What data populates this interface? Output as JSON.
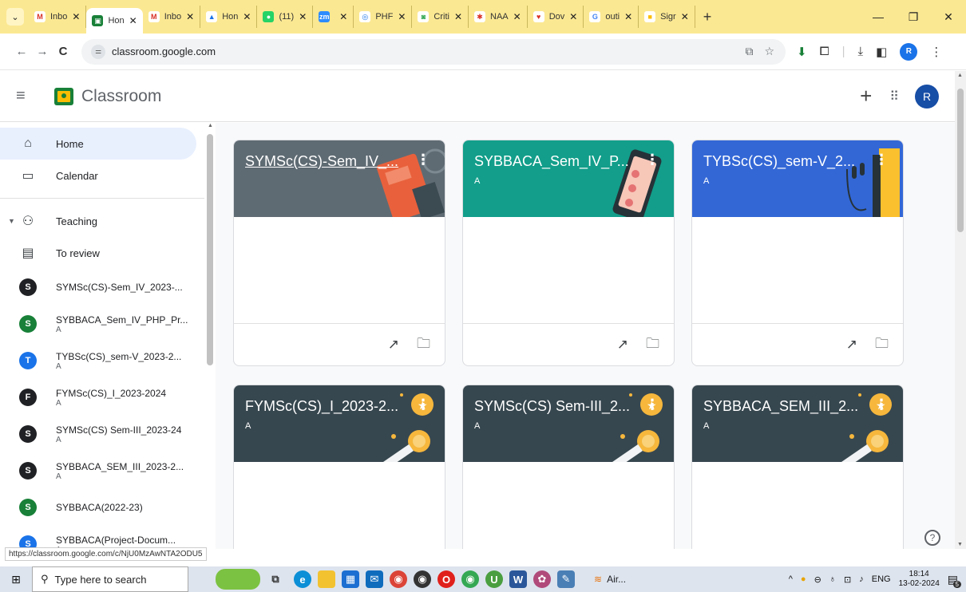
{
  "browser": {
    "tabs": [
      {
        "label": "Inbo",
        "fav": "M",
        "color": "#ffffff",
        "fg": "#d93025",
        "active": false
      },
      {
        "label": "Hon",
        "fav": "▣",
        "color": "#188038",
        "fg": "#ffffff",
        "active": true
      },
      {
        "label": "Inbo",
        "fav": "M",
        "color": "#ffffff",
        "fg": "#d93025",
        "active": false
      },
      {
        "label": "Hon",
        "fav": "▲",
        "color": "#ffffff",
        "fg": "#1a73e8",
        "active": false
      },
      {
        "label": "(11)",
        "fav": "●",
        "color": "#25d366",
        "fg": "#ffffff",
        "active": false
      },
      {
        "label": "",
        "fav": "zm",
        "color": "#2d8cff",
        "fg": "#ffffff",
        "active": false
      },
      {
        "label": "PHF",
        "fav": "◎",
        "color": "#ffffff",
        "fg": "#1a73e8",
        "active": false
      },
      {
        "label": "Criti",
        "fav": "◙",
        "color": "#ffffff",
        "fg": "#34a853",
        "active": false
      },
      {
        "label": "NAA",
        "fav": "✱",
        "color": "#ffffff",
        "fg": "#d93025",
        "active": false
      },
      {
        "label": "Dov",
        "fav": "♥",
        "color": "#ffffff",
        "fg": "#d93025",
        "active": false
      },
      {
        "label": "outi",
        "fav": "G",
        "color": "#ffffff",
        "fg": "#4285f4",
        "active": false
      },
      {
        "label": "Sigr",
        "fav": "■",
        "color": "#ffffff",
        "fg": "#fbbc04",
        "active": false
      }
    ],
    "new_tab": "+",
    "url": "classroom.google.com",
    "profile_initial": "R",
    "status_url": "https://classroom.google.com/c/NjU0MzAwNTA2ODU5"
  },
  "app": {
    "title": "Classroom",
    "avatar_initial": "R"
  },
  "sidebar": {
    "nav": [
      {
        "label": "Home",
        "icon": "home-icon",
        "glyph": "⌂",
        "active": true
      },
      {
        "label": "Calendar",
        "icon": "calendar-icon",
        "glyph": "▭",
        "active": false
      }
    ],
    "teaching_label": "Teaching",
    "to_review_label": "To review",
    "classes": [
      {
        "initial": "S",
        "name": "SYMSc(CS)-Sem_IV_2023-...",
        "sub": "",
        "color": "#202124"
      },
      {
        "initial": "S",
        "name": "SYBBACA_Sem_IV_PHP_Pr...",
        "sub": "A",
        "color": "#188038"
      },
      {
        "initial": "T",
        "name": "TYBSc(CS)_sem-V_2023-2...",
        "sub": "A",
        "color": "#1a73e8"
      },
      {
        "initial": "F",
        "name": "FYMSc(CS)_I_2023-2024",
        "sub": "A",
        "color": "#202124"
      },
      {
        "initial": "S",
        "name": "SYMSc(CS) Sem-III_2023-24",
        "sub": "A",
        "color": "#202124"
      },
      {
        "initial": "S",
        "name": "SYBBACA_SEM_III_2023-2...",
        "sub": "A",
        "color": "#202124"
      },
      {
        "initial": "S",
        "name": "SYBBACA(2022-23)",
        "sub": "",
        "color": "#188038"
      },
      {
        "initial": "S",
        "name": "SYBBACA(Project-Docum...",
        "sub": "A",
        "color": "#1a73e8"
      }
    ]
  },
  "cards": [
    {
      "title": "SYMSc(CS)-Sem_IV_...",
      "sub": "",
      "color": "#5f6b73",
      "deco": "book",
      "underline": true
    },
    {
      "title": "SYBBACA_Sem_IV_P...",
      "sub": "A",
      "color": "#129e8a",
      "deco": "phone",
      "underline": false
    },
    {
      "title": "TYBSc(CS)_sem-V_2...",
      "sub": "A",
      "color": "#3367d6",
      "deco": "headphones",
      "underline": false
    },
    {
      "title": "FYMSc(CS)_I_2023-2...",
      "sub": "A",
      "color": "#37474f",
      "deco": "medal",
      "underline": false
    },
    {
      "title": "SYMSc(CS) Sem-III_2...",
      "sub": "A",
      "color": "#37474f",
      "deco": "medal",
      "underline": false
    },
    {
      "title": "SYBBACA_SEM_III_2...",
      "sub": "A",
      "color": "#37474f",
      "deco": "medal",
      "underline": false
    }
  ],
  "taskbar": {
    "search_placeholder": "Type here to search",
    "air_label": "Air...",
    "lang": "ENG",
    "time": "18:14",
    "date": "13-02-2024",
    "notif_count": "5"
  }
}
